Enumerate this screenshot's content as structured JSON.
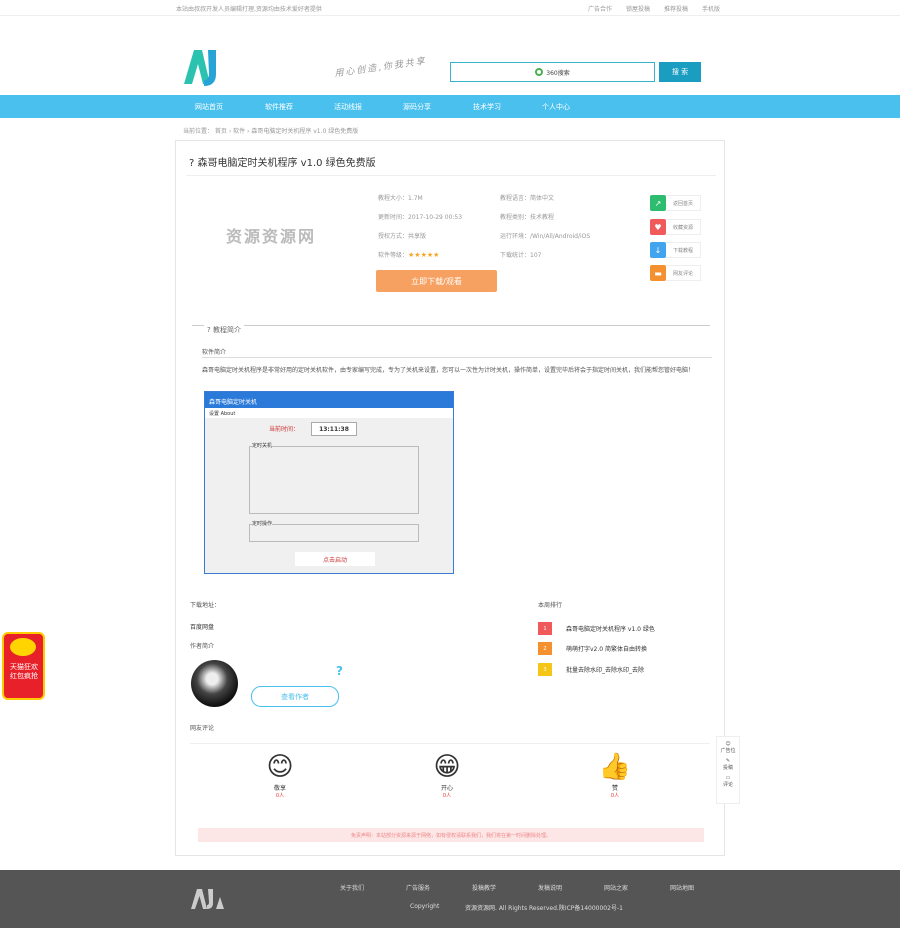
{
  "topbar": {
    "message": "本站由叔叔开发人员编辑打理,资源均由技术爱好者提供",
    "links": [
      "广告合作",
      "锁屋投稿",
      "推荐投稿",
      "手机版"
    ]
  },
  "header": {
    "slogan": "用心创造,你我共享",
    "search_placeholder": "360搜索",
    "search_button": "搜 索"
  },
  "nav": [
    "网站首页",
    "软件推荐",
    "活动线报",
    "源码分享",
    "技术学习",
    "个人中心"
  ],
  "breadcrumb": "当前位置： 首页 › 软件 › 森哥电脑定时关机程序 v1.0 绿色免费版",
  "title": "森哥电脑定时关机程序 v1.0 绿色免费版",
  "thumb_text": "资源资源网",
  "info": {
    "size": "教程大小：1.7M",
    "lang": "教程语言：简体中文",
    "update": "更新时间：2017-10-29 00:53",
    "category": "教程类别：技术教程",
    "license": "授权方式：共享版",
    "platform": "运行环境：/Win/All/Android/iOS",
    "rating_label": "软件等级：",
    "rating": "★★★★★",
    "downloads": "下载统计：107"
  },
  "download_button": "立即下载/观看",
  "side_actions": [
    {
      "label": "返回首页",
      "color": "#2ebc70",
      "icon": "↗"
    },
    {
      "label": "收藏资源",
      "color": "#f05a5a",
      "icon": "♥"
    },
    {
      "label": "下载教程",
      "color": "#42a4ef",
      "icon": "↓"
    },
    {
      "label": "网友评论",
      "color": "#f5902e",
      "icon": "▬"
    }
  ],
  "section_title": "教程简介",
  "sub_title": "软件简介",
  "description": "森哥电脑定时关机程序是非常好用的定时关机软件，由专家编写完成，专为了关机来设置，您可以一次性为计时关机，操作简单，设置完毕后将会于指定时间关机，我们能帮您管好电脑！",
  "screenshot": {
    "title": "森哥电脑定时关机",
    "menu": "设置  About",
    "time_label": "当前时间：",
    "time": "13:11:38",
    "group1": "定时关机",
    "group2": "定时操作",
    "dl_btn": "点击启动"
  },
  "download_label": "下载地址：",
  "download_link": "百度网盘",
  "author_label": "作者简介",
  "view_author": "查看作者",
  "rank_title": "本周排行",
  "ranking": [
    {
      "num": "1",
      "text": "森哥电脑定时关机程序 v1.0 绿色",
      "color": "#f05a5a"
    },
    {
      "num": "2",
      "text": "萌萌打字v2.0 简繁体自由转换",
      "color": "#f5902e"
    },
    {
      "num": "3",
      "text": "批量去除水印_去除水印_去除",
      "color": "#f5c518"
    }
  ],
  "comment_label": "网友评论",
  "reactions": [
    {
      "name": "敬享",
      "count": "0人",
      "face": "😊"
    },
    {
      "name": "开心",
      "count": "0人",
      "face": "😁"
    },
    {
      "name": "赞",
      "count": "0人",
      "face": "👍"
    }
  ],
  "notice": "免责声明：本站部分资源来源于网络，如有侵权请联系我们，我们将在第一时间删除处理。",
  "footer": {
    "links": [
      "关于我们",
      "广告服务",
      "投稿教学",
      "发稿说明",
      "网站之家",
      "网站地图"
    ],
    "copyright": "Copyright",
    "rights": "资源资源网. All Rights Reserved.陕ICP备14000002号-1"
  },
  "redpack": {
    "line1": "天猫狂欢",
    "line2": "红包疯抢"
  },
  "float": [
    "广告位",
    "投稿",
    "评论"
  ]
}
